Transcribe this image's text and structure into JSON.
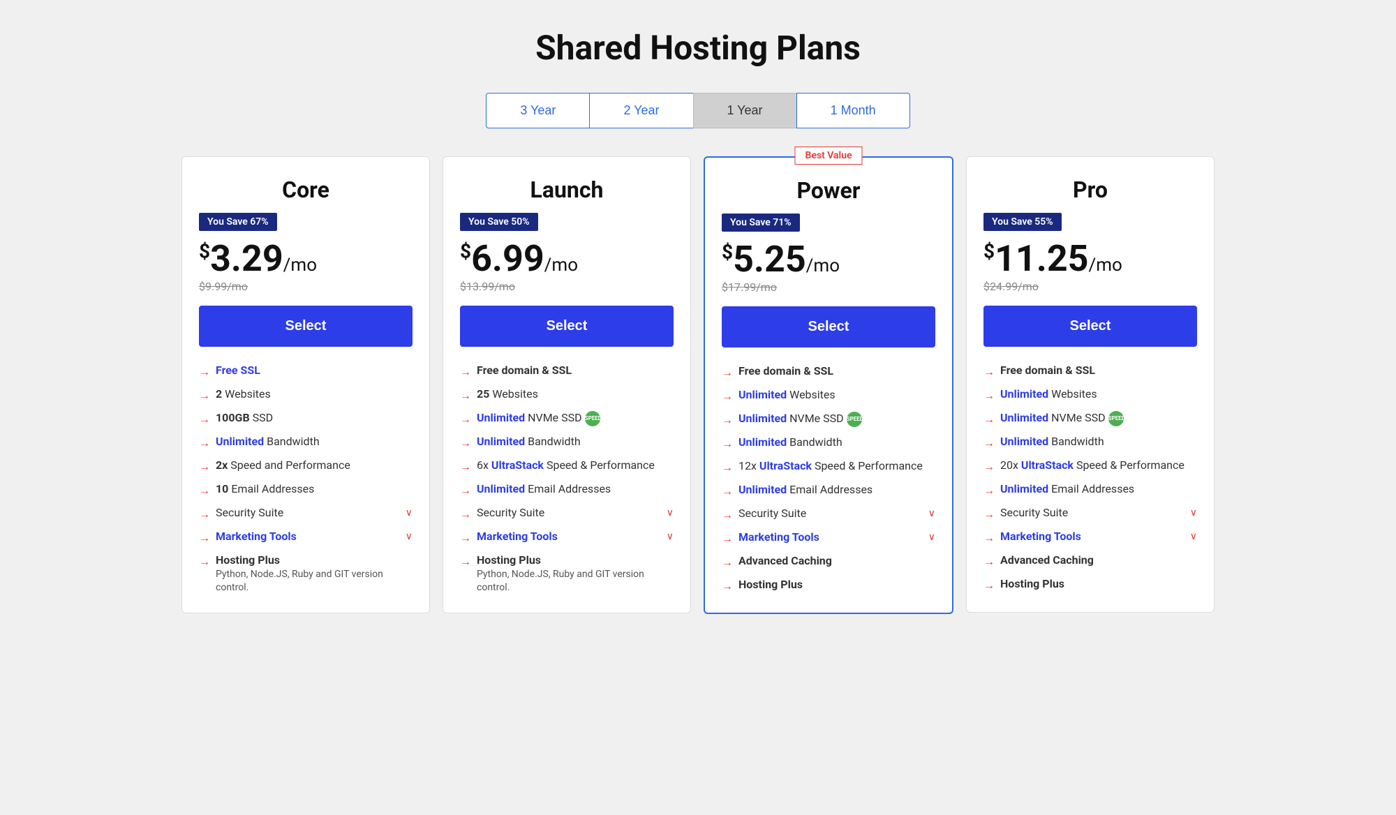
{
  "page": {
    "title": "Shared Hosting Plans"
  },
  "billing": {
    "tabs": [
      {
        "id": "3year",
        "label": "3 Year",
        "active": false
      },
      {
        "id": "2year",
        "label": "2 Year",
        "active": false
      },
      {
        "id": "1year",
        "label": "1 Year",
        "active": true
      },
      {
        "id": "1month",
        "label": "1 Month",
        "active": false
      }
    ]
  },
  "plans": [
    {
      "id": "core",
      "name": "Core",
      "featured": false,
      "best_value": false,
      "savings": "You Save 67%",
      "price": "3.29",
      "original_price": "$9.99/mo",
      "select_label": "Select",
      "features": [
        {
          "highlight": "Free SSL",
          "rest": "",
          "expandable": false,
          "blue_highlight": true
        },
        {
          "highlight": "2",
          "rest": " Websites",
          "expandable": false
        },
        {
          "highlight": "100GB",
          "rest": " SSD",
          "expandable": false,
          "bold_highlight": true
        },
        {
          "highlight": "Unlimited",
          "rest": " Bandwidth",
          "expandable": false,
          "blue_highlight": true
        },
        {
          "highlight": "2x",
          "rest": " Speed and Performance",
          "expandable": false
        },
        {
          "highlight": "10",
          "rest": " Email Addresses",
          "expandable": false
        },
        {
          "highlight": "",
          "rest": "Security Suite",
          "expandable": true
        },
        {
          "highlight": "Marketing Tools",
          "rest": "",
          "expandable": true,
          "blue_highlight": true
        },
        {
          "highlight": "Hosting Plus",
          "rest": "\nPython, Node.JS, Ruby and GIT version control.",
          "expandable": false,
          "bold_highlight": true
        }
      ]
    },
    {
      "id": "launch",
      "name": "Launch",
      "featured": false,
      "best_value": false,
      "savings": "You Save 50%",
      "price": "6.99",
      "original_price": "$13.99/mo",
      "select_label": "Select",
      "features": [
        {
          "highlight": "Free domain & SSL",
          "rest": "",
          "expandable": false,
          "bold_highlight": true
        },
        {
          "highlight": "25",
          "rest": " Websites",
          "expandable": false
        },
        {
          "highlight": "Unlimited",
          "rest": " NVMe SSD",
          "expandable": false,
          "blue_highlight": true,
          "speed": true
        },
        {
          "highlight": "Unlimited",
          "rest": " Bandwidth",
          "expandable": false,
          "blue_highlight": true
        },
        {
          "highlight": "6x",
          "rest": " UltraStack Speed & Performance",
          "expandable": false,
          "ultrastack": true
        },
        {
          "highlight": "Unlimited",
          "rest": " Email Addresses",
          "expandable": false,
          "blue_highlight": true
        },
        {
          "highlight": "",
          "rest": "Security Suite",
          "expandable": true
        },
        {
          "highlight": "Marketing Tools",
          "rest": "",
          "expandable": true,
          "blue_highlight": true
        },
        {
          "highlight": "Hosting Plus",
          "rest": "\nPython, Node.JS, Ruby and GIT version control.",
          "expandable": false,
          "bold_highlight": true
        }
      ]
    },
    {
      "id": "power",
      "name": "Power",
      "featured": true,
      "best_value": true,
      "best_value_label": "Best Value",
      "savings": "You Save 71%",
      "price": "5.25",
      "original_price": "$17.99/mo",
      "select_label": "Select",
      "features": [
        {
          "highlight": "Free domain & SSL",
          "rest": "",
          "expandable": false,
          "bold_highlight": true
        },
        {
          "highlight": "Unlimited",
          "rest": " Websites",
          "expandable": false,
          "blue_highlight": true
        },
        {
          "highlight": "Unlimited",
          "rest": " NVMe SSD",
          "expandable": false,
          "blue_highlight": true,
          "speed": true
        },
        {
          "highlight": "Unlimited",
          "rest": " Bandwidth",
          "expandable": false,
          "blue_highlight": true
        },
        {
          "highlight": "12x",
          "rest": " UltraStack Speed & Performance",
          "expandable": false,
          "ultrastack": true
        },
        {
          "highlight": "Unlimited",
          "rest": " Email Addresses",
          "expandable": false,
          "blue_highlight": true
        },
        {
          "highlight": "",
          "rest": "Security Suite",
          "expandable": true
        },
        {
          "highlight": "Marketing Tools",
          "rest": "",
          "expandable": true,
          "blue_highlight": true
        },
        {
          "highlight": "Advanced Caching",
          "rest": "",
          "expandable": false,
          "bold_highlight": true
        },
        {
          "highlight": "Hosting Plus",
          "rest": "",
          "expandable": false,
          "bold_highlight": true
        }
      ]
    },
    {
      "id": "pro",
      "name": "Pro",
      "featured": false,
      "best_value": false,
      "savings": "You Save 55%",
      "price": "11.25",
      "original_price": "$24.99/mo",
      "select_label": "Select",
      "features": [
        {
          "highlight": "Free domain & SSL",
          "rest": "",
          "expandable": false,
          "bold_highlight": true
        },
        {
          "highlight": "Unlimited",
          "rest": " Websites",
          "expandable": false,
          "blue_highlight": true
        },
        {
          "highlight": "Unlimited",
          "rest": " NVMe SSD",
          "expandable": false,
          "blue_highlight": true,
          "speed": true
        },
        {
          "highlight": "Unlimited",
          "rest": " Bandwidth",
          "expandable": false,
          "blue_highlight": true
        },
        {
          "highlight": "20x",
          "rest": " UltraStack Speed & Performance",
          "expandable": false,
          "ultrastack": true
        },
        {
          "highlight": "Unlimited",
          "rest": " Email Addresses",
          "expandable": false,
          "blue_highlight": true
        },
        {
          "highlight": "",
          "rest": "Security Suite",
          "expandable": true
        },
        {
          "highlight": "Marketing Tools",
          "rest": "",
          "expandable": true,
          "blue_highlight": true
        },
        {
          "highlight": "Advanced Caching",
          "rest": "",
          "expandable": false,
          "bold_highlight": true
        },
        {
          "highlight": "Hosting Plus",
          "rest": "",
          "expandable": false,
          "bold_highlight": true
        }
      ]
    }
  ]
}
